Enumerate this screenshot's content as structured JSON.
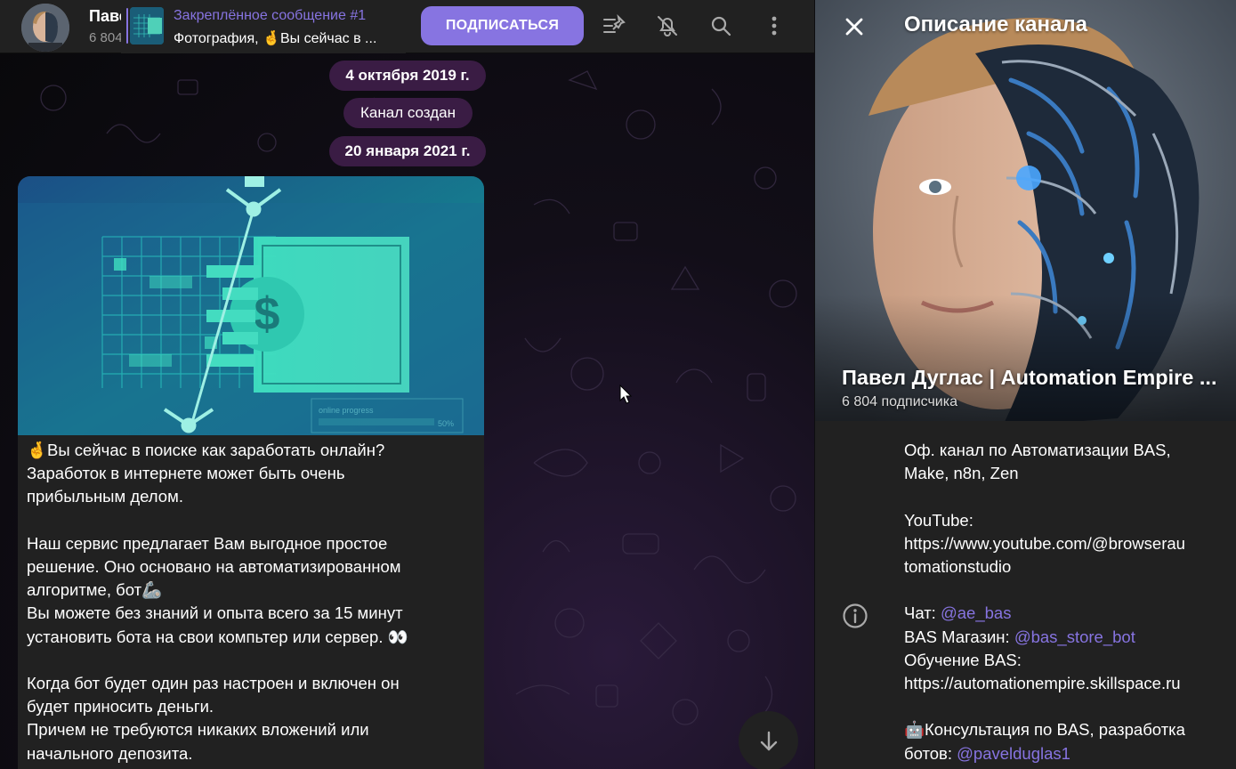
{
  "header": {
    "channel_name": "Павел Дуглас | Automation Empire",
    "channel_sub": "6 804 подписчика",
    "pinned_title": "Закреплённое сообщение #1",
    "pinned_text": "Фотография, 🤞Вы сейчас в ...",
    "subscribe_label": "ПОДПИСАТЬСЯ",
    "icons": [
      "pin-list-icon",
      "bell-muted-icon",
      "search-icon",
      "more-vertical-icon"
    ]
  },
  "chat": {
    "date1": "4 октября 2019 г.",
    "service_msg": "Канал создан",
    "date2": "20 января 2021 г.",
    "image_caption": "online progress",
    "image_percent": "50%",
    "message_lines": [
      "🤞Вы сейчас в поиске как заработать онлайн?",
      "Заработок в интернете может быть очень",
      "прибыльным делом.",
      "",
      "Наш сервис предлагает Вам выгодное простое",
      "решение. Оно основано на автоматизированном",
      "алгоритме, бот🦾",
      "Вы можете без знаний и опыта всего за 15 минут",
      "установить бота на свои компьтер или сервер. 👀",
      "",
      "Когда бот будет один раз настроен и включен он",
      "будет приносить деньги.",
      "Причем не требуются никаких вложений или",
      "начального депозита."
    ]
  },
  "panel": {
    "title": "Описание канала",
    "name": "Павел Дуглас | Automation Empire ...",
    "subscribers": "6 804 подписчика",
    "desc": {
      "l1": "Оф. канал по Автоматизации BAS,",
      "l2": "Make, n8n, Zen",
      "l3": "YouTube:",
      "l4": "https://www.youtube.com/@browserau",
      "l5": "tomationstudio",
      "chat_label": "Чат: ",
      "chat_link": "@ae_bas",
      "shop_label": "BAS Магазин: ",
      "shop_link": "@bas_store_bot",
      "edu_label": "Обучение BAS:",
      "edu_url": "https://automationempire.skillspace.ru",
      "consult": "🤖Консультация по BAS, разработка",
      "bots_label": "ботов: ",
      "bots_link": "@pavelduglas1"
    }
  },
  "colors": {
    "accent": "#8774e1",
    "panel_bg": "#212121",
    "date_pill": "#3a1c44"
  }
}
